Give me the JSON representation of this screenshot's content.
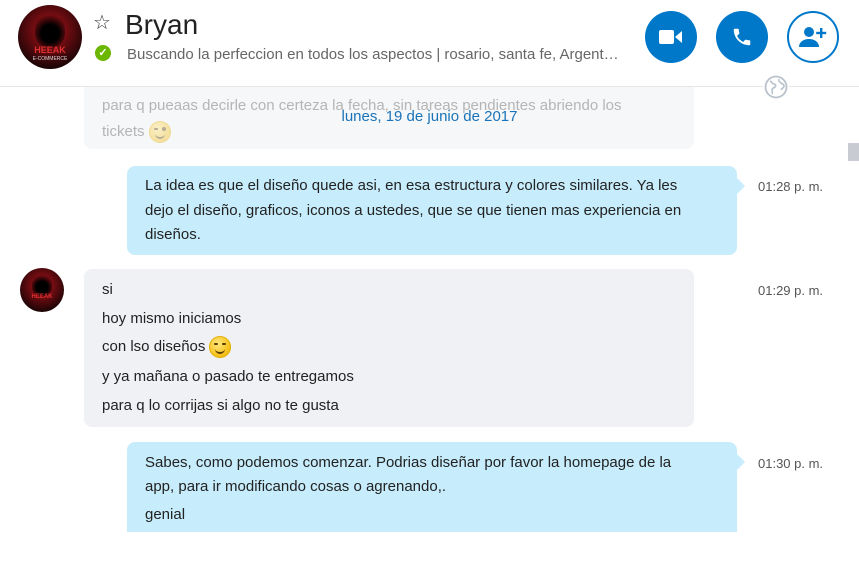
{
  "contact": {
    "name": "Bryan",
    "mood": "Buscando la perfeccion en todos los aspectos  |  rosario, santa fe, Argent…",
    "avatar_logo": "HEEAK",
    "avatar_logo_sub": "E-COMMERCE"
  },
  "header": {
    "buttons": [
      {
        "name": "video-call-button",
        "icon": "video-camera-icon"
      },
      {
        "name": "audio-call-button",
        "icon": "phone-icon"
      },
      {
        "name": "add-people-button",
        "icon": "add-person-icon"
      }
    ]
  },
  "conversation": {
    "faded_top_line": "para q pueaas decirle con certeza la fecha, sin tareas pendientes abriendo los",
    "faded_top_line2": "tickets",
    "date_separator": "lunes, 19 de junio de 2017",
    "messages": [
      {
        "direction": "out",
        "lines": [
          "La idea es que el diseño quede asi, en esa estructura y colores similares. Ya les",
          "dejo el diseño, graficos, iconos a ustedes, que se que tienen mas experiencia en",
          "diseños."
        ],
        "time": "01:28 p. m."
      },
      {
        "direction": "in",
        "lines": [
          "si",
          "hoy mismo iniciamos",
          "con lso diseños",
          "y ya mañana o pasado te entregamos",
          "para q lo corrijas si algo no te gusta"
        ],
        "time": "01:29 p. m."
      },
      {
        "direction": "out",
        "lines": [
          "Sabes, como podemos comenzar. Podrias diseñar por favor la homepage de la",
          "app, para ir modificando cosas o agrenando,.",
          "genial"
        ],
        "time": "01:30 p. m."
      }
    ]
  },
  "colors": {
    "accent": "#0078ca",
    "outgoing_bubble": "#c7edfc",
    "incoming_bubble": "#eff1f4",
    "online": "#6bb700",
    "date_text": "#1a73b8"
  }
}
